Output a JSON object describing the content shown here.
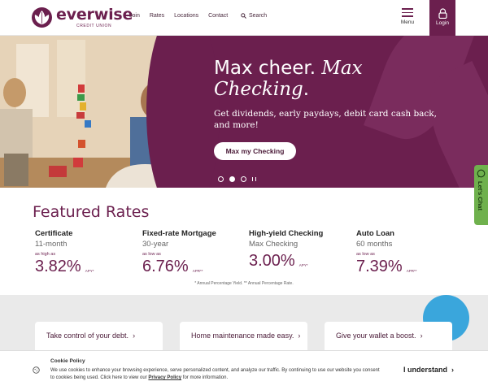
{
  "brand": {
    "name": "everwise",
    "sub": "CREDIT UNION",
    "color": "#6b1f4e"
  },
  "nav": {
    "items": [
      "Join",
      "Rates",
      "Locations",
      "Contact"
    ],
    "search_label": "Search"
  },
  "header": {
    "menu_label": "Menu",
    "login_label": "Login"
  },
  "hero": {
    "title_plain": "Max cheer. ",
    "title_italic_1": "Max",
    "title_italic_2": "Checking",
    "title_period": ".",
    "text": "Get dividends, early paydays, debit card cash back, and more!",
    "button_label": "Max my Checking",
    "slides": {
      "count": 3,
      "active": 2
    }
  },
  "chat": {
    "label": "Let's Chat"
  },
  "rates": {
    "title": "Featured Rates",
    "items": [
      {
        "name": "Certificate",
        "term": "11-month",
        "qualifier": "as high as",
        "value": "3.82%",
        "unit": "APY*"
      },
      {
        "name": "Fixed-rate Mortgage",
        "term": "30-year",
        "qualifier": "as low as",
        "value": "6.76%",
        "unit": "APR**"
      },
      {
        "name": "High-yield Checking",
        "term": "Max Checking",
        "qualifier": "",
        "value": "3.00%",
        "unit": "APY*"
      },
      {
        "name": "Auto Loan",
        "term": "60 months",
        "qualifier": "as low as",
        "value": "7.39%",
        "unit": "APR**"
      }
    ],
    "footnote": "* Annual Percentage Yield. ** Annual Percentage Rate."
  },
  "cards": [
    {
      "label": "Take control of your debt."
    },
    {
      "label": "Home maintenance made easy."
    },
    {
      "label": "Give your wallet a boost."
    }
  ],
  "cookie": {
    "title": "Cookie Policy",
    "text_1": "We use cookies to enhance your browsing experience, serve personalized content, and analyze our traffic. By continuing to use our website you consent to cookies being used. Click here to view our ",
    "link": "Privacy Policy",
    "text_2": " for more information.",
    "button_label": "I understand"
  }
}
